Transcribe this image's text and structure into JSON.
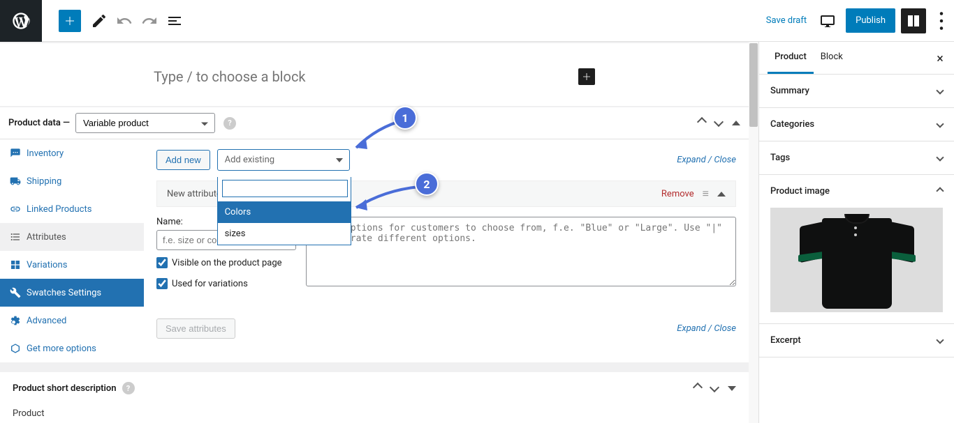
{
  "toolbar": {
    "save_draft": "Save draft",
    "publish": "Publish"
  },
  "block_placeholder": "Type / to choose a block",
  "product_data": {
    "title": "Product data —",
    "type_selected": "Variable product",
    "tabs": {
      "inventory": "Inventory",
      "shipping": "Shipping",
      "linked_products": "Linked Products",
      "attributes": "Attributes",
      "variations": "Variations",
      "swatches_settings": "Swatches Settings",
      "advanced": "Advanced",
      "get_more": "Get more options"
    },
    "add_new": "Add new",
    "add_existing_placeholder": "Add existing",
    "dropdown": {
      "opt1": "Colors",
      "opt2": "sizes"
    },
    "expand_collapse": "Expand / Close",
    "new_attribute_label": "New attribute",
    "remove_label": "Remove",
    "name_label": "Name:",
    "name_placeholder": "f.e. size or color",
    "values_placeholder": "Enter options for customers to choose from, f.e. \"Blue\" or \"Large\". Use \"|\" to separate different options.",
    "visible_label": "Visible on the product page",
    "used_variations_label": "Used for variations",
    "save_attributes": "Save attributes"
  },
  "short_desc": {
    "title": "Product short description"
  },
  "footer": "Product",
  "right_sidebar": {
    "tab_product": "Product",
    "tab_block": "Block",
    "summary": "Summary",
    "categories": "Categories",
    "tags": "Tags",
    "product_image": "Product image",
    "excerpt": "Excerpt"
  },
  "annotations": {
    "badge1": "1",
    "badge2": "2"
  }
}
